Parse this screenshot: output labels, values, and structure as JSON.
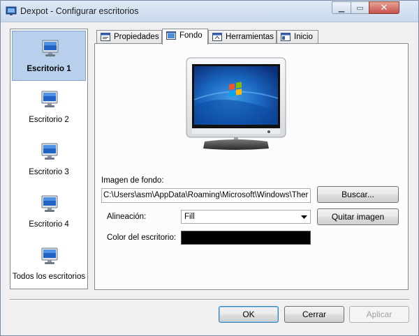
{
  "window": {
    "title": "Dexpot - Configurar escritorios"
  },
  "sidebar": {
    "items": [
      {
        "label": "Escritorio 1"
      },
      {
        "label": "Escritorio 2"
      },
      {
        "label": "Escritorio 3"
      },
      {
        "label": "Escritorio 4"
      },
      {
        "label": "Todos los escritorios"
      }
    ],
    "selected_index": 0
  },
  "tabs": [
    {
      "label": "Propiedades",
      "icon": "properties-icon"
    },
    {
      "label": "Fondo",
      "icon": "background-icon"
    },
    {
      "label": "Herramientas",
      "icon": "tools-icon"
    },
    {
      "label": "Inicio",
      "icon": "start-icon"
    }
  ],
  "active_tab": "Fondo",
  "background": {
    "image_label": "Imagen de fondo:",
    "image_path": "C:\\Users\\asm\\AppData\\Roaming\\Microsoft\\Windows\\Ther",
    "browse_button": "Buscar...",
    "alignment_label": "Alineación:",
    "alignment_value": "Fill",
    "remove_image_button": "Quitar imagen",
    "desktop_color_label": "Color del escritorio:",
    "desktop_color": "#000000"
  },
  "footer": {
    "ok": "OK",
    "close": "Cerrar",
    "apply": "Aplicar"
  }
}
